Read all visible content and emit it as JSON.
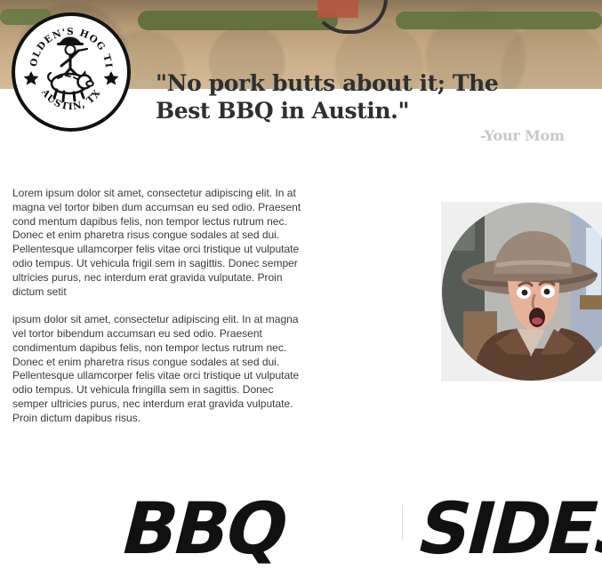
{
  "logo": {
    "top_text": "HOLDEN'S HOG TIE",
    "bottom_text": "AUSTIN, TX",
    "icon_name": "pig-rider-icon"
  },
  "testimonial": {
    "quote_line1": "\"No pork butts about it; The",
    "quote_line2": "Best BBQ in Austin.\"",
    "author": "-Your Mom"
  },
  "content": {
    "paragraph_1": "Lorem ipsum dolor sit amet, consectetur adipiscing elit. In at magna vel tortor biben dum accumsan eu sed odio. Praesent cond mentum dapibus felis, non tempor lectus rutrum nec. Donec et enim pharetra risus congue sodales at sed dui. Pellentesque ullamcorper felis vitae orci tristique ut vulputate odio tempus. Ut vehicula frigil sem in sagittis. Donec semper ultricies purus, nec interdum erat gravida vulputate. Proin dictum setit",
    "paragraph_2": "ipsum dolor sit amet, consectetur adipiscing elit. In at magna vel tortor bibendum accumsan eu sed odio. Praesent condimentum dapibus felis, non tempor lectus rutrum nec. Donec et enim pharetra risus congue sodales at sed dui. Pellentesque ullamcorper felis vitae orci tristique ut vulputate odio tempus. Ut vehicula fringilla sem in sagittis. Donec semper ultricies purus, nec interdum erat gravida vulputate. Proin dictum dapibus risus."
  },
  "portrait": {
    "icon_name": "cowboy-portrait"
  },
  "sections": {
    "bbq_title": "BBQ",
    "sides_title": "SIDES"
  },
  "colors": {
    "text_dark": "#2f2f2f",
    "text_body": "#3a3a3a",
    "muted": "#c7c7c7",
    "border": "#111111",
    "panel": "#efefef"
  }
}
